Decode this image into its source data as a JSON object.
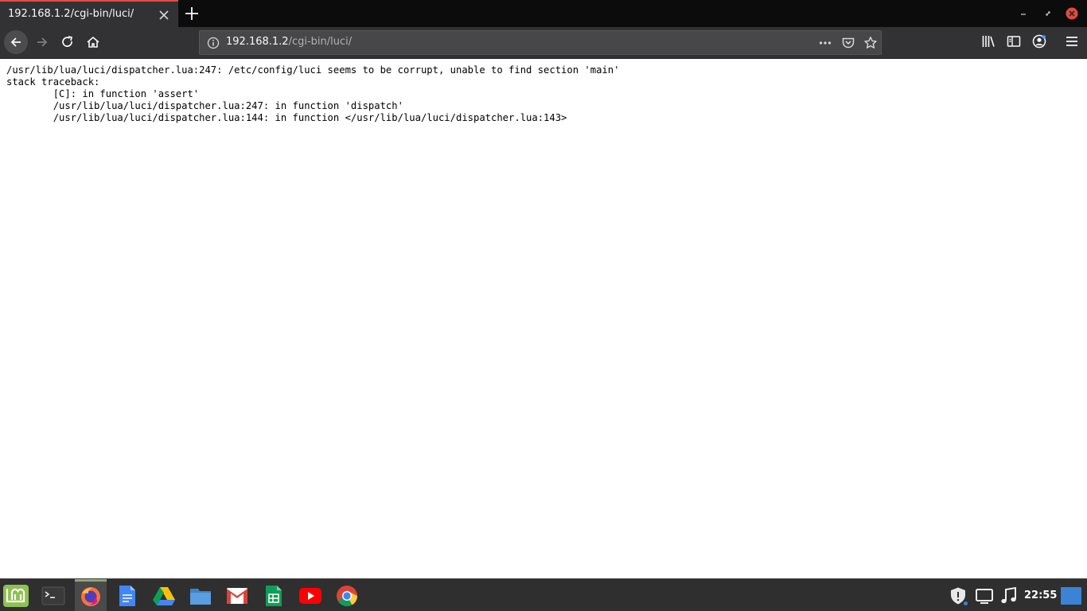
{
  "browser": {
    "tab": {
      "title": "192.168.1.2/cgi-bin/luci/"
    },
    "urlbar": {
      "host": "192.168.1.2",
      "path": "/cgi-bin/luci/"
    },
    "toolbar_icons": [
      "back-icon",
      "forward-icon",
      "reload-icon",
      "home-icon",
      "page-actions-icon",
      "pocket-icon",
      "bookmark-star-icon",
      "library-icon",
      "sidebar-icon",
      "account-icon",
      "menu-icon"
    ]
  },
  "page": {
    "error_lines": [
      "/usr/lib/lua/luci/dispatcher.lua:247: /etc/config/luci seems to be corrupt, unable to find section 'main'",
      "stack traceback:",
      "        [C]: in function 'assert'",
      "        /usr/lib/lua/luci/dispatcher.lua:247: in function 'dispatch'",
      "        /usr/lib/lua/luci/dispatcher.lua:144: in function </usr/lib/lua/luci/dispatcher.lua:143>"
    ]
  },
  "taskbar": {
    "apps": [
      "mint-menu-icon",
      "terminal-icon",
      "firefox-icon",
      "docs-icon",
      "drive-icon",
      "files-icon",
      "gmail-icon",
      "sheets-icon",
      "youtube-icon",
      "chrome-icon"
    ],
    "clock": "22:55",
    "accent": "#8fa876"
  }
}
